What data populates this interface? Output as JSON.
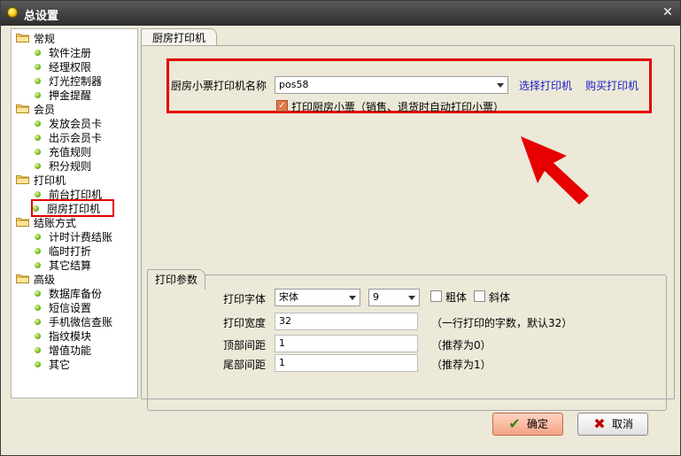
{
  "window": {
    "title": "总设置",
    "close_glyph": "✕"
  },
  "tree": {
    "groups": [
      {
        "label": "常规",
        "items": [
          "软件注册",
          "经理权限",
          "灯光控制器",
          "押金提醒"
        ]
      },
      {
        "label": "会员",
        "items": [
          "发放会员卡",
          "出示会员卡",
          "充值规则",
          "积分规则"
        ]
      },
      {
        "label": "打印机",
        "items": [
          "前台打印机",
          "厨房打印机"
        ]
      },
      {
        "label": "结账方式",
        "items": [
          "计时计费结账",
          "临时打折",
          "其它结算"
        ]
      },
      {
        "label": "高级",
        "items": [
          "数据库备份",
          "短信设置",
          "手机微信查账",
          "指纹模块",
          "增值功能",
          "其它"
        ]
      }
    ],
    "selected": "厨房打印机"
  },
  "tab": {
    "label": "厨房打印机"
  },
  "printer": {
    "name_label": "厨房小票打印机名称",
    "name_value": "pos58",
    "select_link": "选择打印机",
    "buy_link": "购买打印机",
    "print_check_label": "打印厨房小票（销售、退货时自动打印小票）",
    "print_checked": true
  },
  "params": {
    "group_label": "打印参数",
    "font_label": "打印字体",
    "font_value": "宋体",
    "size_value": "9",
    "bold_label": "粗体",
    "italic_label": "斜体",
    "width_label": "打印宽度",
    "width_value": "32",
    "width_hint": "（一行打印的字数，默认32）",
    "top_label": "顶部间距",
    "top_value": "1",
    "top_hint": "（推荐为0）",
    "bottom_label": "尾部间距",
    "bottom_value": "1",
    "bottom_hint": "（推荐为1）"
  },
  "buttons": {
    "ok": "确定",
    "cancel": "取消"
  },
  "colors": {
    "highlight": "#e60000",
    "link": "#1a1ac8"
  }
}
